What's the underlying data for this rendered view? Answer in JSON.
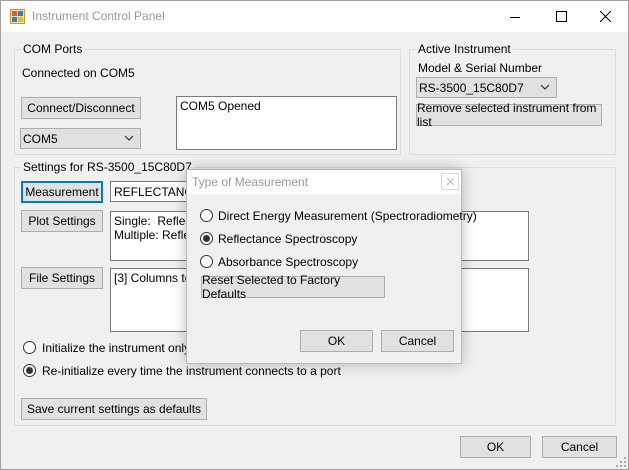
{
  "window": {
    "title": "Instrument Control Panel"
  },
  "com_ports": {
    "group_title": "COM Ports",
    "status": "Connected on COM5",
    "connect_button": "Connect/Disconnect",
    "port_selected": "COM5",
    "log": "COM5 Opened"
  },
  "active_instrument": {
    "group_title": "Active Instrument",
    "subtitle": "Model & Serial Number",
    "selected": "RS-3500_15C80D7",
    "remove_button": "Remove selected instrument from list"
  },
  "settings": {
    "group_title": "Settings for RS-3500_15C80D7",
    "measurement_button": "Measurement",
    "measurement_value": "REFLECTANCE",
    "plot_button": "Plot Settings",
    "plot_text": "Single:  Reflecta\nMultiple: Reflect",
    "file_button": "File Settings",
    "file_text": "[3] Columns to D",
    "radio_init_once": "Initialize the instrument only onc",
    "radio_reinit": "Re-initialize every time the instrument connects to a port",
    "save_defaults_button": "Save current settings as defaults"
  },
  "footer": {
    "ok": "OK",
    "cancel": "Cancel"
  },
  "dialog": {
    "title": "Type of Measurement",
    "options": [
      {
        "label": "Direct Energy Measurement (Spectroradiometry)",
        "checked": false
      },
      {
        "label": "Reflectance Spectroscopy",
        "checked": true
      },
      {
        "label": "Absorbance Spectroscopy",
        "checked": false
      }
    ],
    "reset_button": "Reset Selected to Factory Defaults",
    "ok": "OK",
    "cancel": "Cancel"
  }
}
